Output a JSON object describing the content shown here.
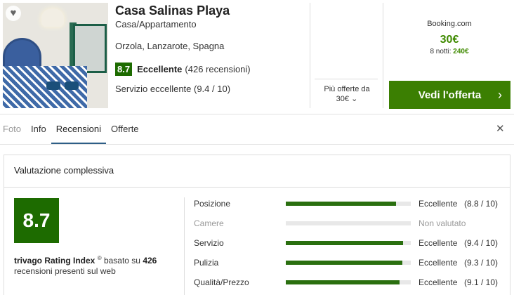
{
  "listing": {
    "name": "Casa Salinas Playa",
    "type": "Casa/Appartamento",
    "location": "Orzola, Lanzarote, Spagna",
    "rating_score": "8.7",
    "rating_word": "Eccellente",
    "rating_count": "(426 recensioni)",
    "service_line": "Servizio eccellente (9.4 / 10)"
  },
  "offers": {
    "more_offers_line1": "Più offerte da",
    "more_offers_line2": "30€",
    "provider": "Booking.com",
    "price": "30€",
    "nights_label": "8 notti: ",
    "nights_total": "240€",
    "cta_label": "Vedi l'offerta"
  },
  "tabs": [
    "Foto",
    "Info",
    "Recensioni",
    "Offerte"
  ],
  "active_tab": "Recensioni",
  "reviews": {
    "title": "Valutazione complessiva",
    "score": "8.7",
    "index_name": "trivago Rating Index",
    "index_mark": "®",
    "index_mid": " basato su ",
    "index_count": "426",
    "index_tail": "recensioni presenti sul web",
    "categories": [
      {
        "label": "Posizione",
        "verdict": "Eccellente",
        "score_text": "(8.8 / 10)",
        "value": 8.8
      },
      {
        "label": "Camere",
        "verdict": "Non valutato",
        "score_text": "",
        "value": null
      },
      {
        "label": "Servizio",
        "verdict": "Eccellente",
        "score_text": "(9.4 / 10)",
        "value": 9.4
      },
      {
        "label": "Pulizia",
        "verdict": "Eccellente",
        "score_text": "(9.3 / 10)",
        "value": 9.3
      },
      {
        "label": "Qualità/Prezzo",
        "verdict": "Eccellente",
        "score_text": "(9.1 / 10)",
        "value": 9.1
      }
    ]
  },
  "icons": {
    "favorite": "heart-icon",
    "close": "close-icon",
    "chevron_down": "chevron-down-icon",
    "chevron_right": "chevron-right-icon"
  },
  "colors": {
    "score_green": "#1d6b00",
    "price_green": "#3f8a00",
    "cta_green": "#3b7f02",
    "bar_green": "#2a6f0f"
  }
}
